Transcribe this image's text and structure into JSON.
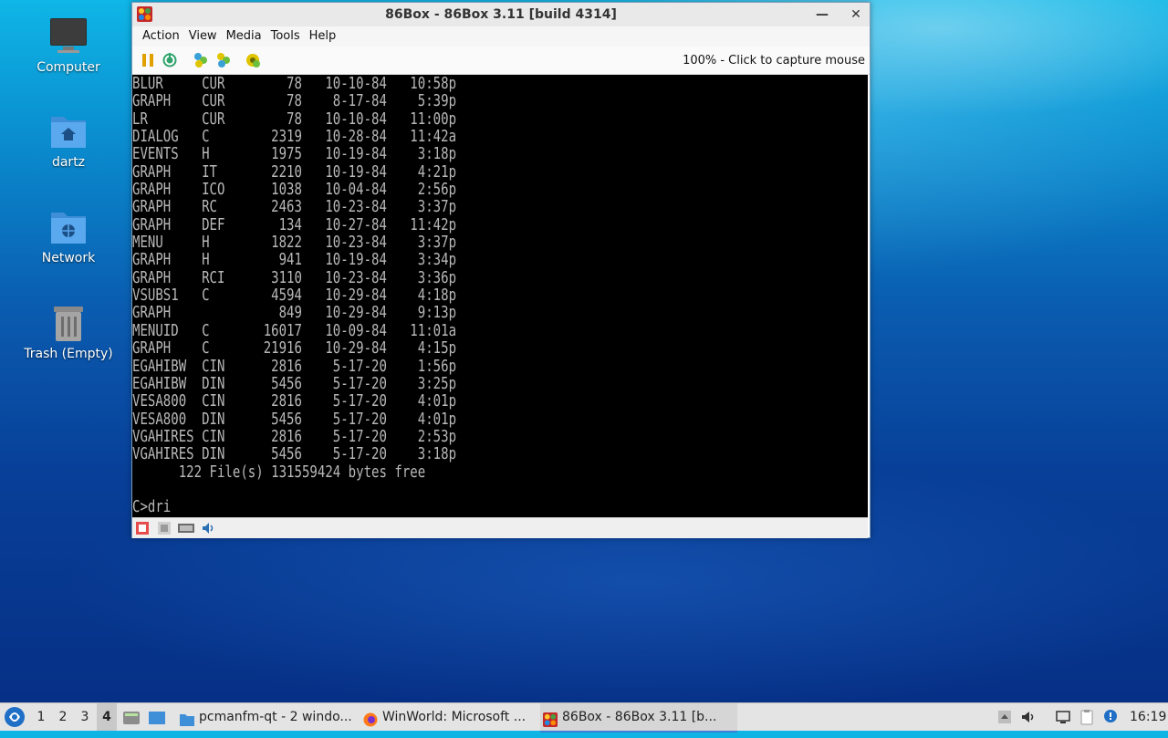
{
  "desktop": {
    "icons": [
      {
        "label": "Computer",
        "icon": "computer-icon"
      },
      {
        "label": "dartz",
        "icon": "home-folder-icon"
      },
      {
        "label": "Network",
        "icon": "network-folder-icon"
      },
      {
        "label": "Trash (Empty)",
        "icon": "trash-icon"
      }
    ]
  },
  "window": {
    "title": "86Box - 86Box 3.11 [build 4314]",
    "minimize": "—",
    "close": "✕",
    "menu": [
      "Action",
      "View",
      "Media",
      "Tools",
      "Help"
    ],
    "toolbar": {
      "buttons": [
        "pause-icon",
        "reset-icon",
        "ctrl-alt-del-icon",
        "ctrl-alt-esc-icon",
        "settings-icon"
      ],
      "status": "100% - Click to capture mouse"
    },
    "screen_text": "BLUR     CUR        78   10-10-84   10:58p\nGRAPH    CUR        78    8-17-84    5:39p\nLR       CUR        78   10-10-84   11:00p\nDIALOG   C        2319   10-28-84   11:42a\nEVENTS   H        1975   10-19-84    3:18p\nGRAPH    IT       2210   10-19-84    4:21p\nGRAPH    ICO      1038   10-04-84    2:56p\nGRAPH    RC       2463   10-23-84    3:37p\nGRAPH    DEF       134   10-27-84   11:42p\nMENU     H        1822   10-23-84    3:37p\nGRAPH    H         941   10-19-84    3:34p\nGRAPH    RCI      3110   10-23-84    3:36p\nVSUBS1   C        4594   10-29-84    4:18p\nGRAPH              849   10-29-84    9:13p\nMENUID   C       16017   10-09-84   11:01a\nGRAPH    C       21916   10-29-84    4:15p\nEGAHIBW  CIN      2816    5-17-20    1:56p\nEGAHIBW  DIN      5456    5-17-20    3:25p\nVESA800  CIN      2816    5-17-20    4:01p\nVESA800  DIN      5456    5-17-20    4:01p\nVGAHIRES CIN      2816    5-17-20    2:53p\nVGAHIRES DIN      5456    5-17-20    3:18p\n      122 File(s) 131559424 bytes free\n\nC>dri",
    "statusbar_icons": [
      "hard-disk-icon",
      "floppy-icon",
      "network-card-icon",
      "sound-icon"
    ]
  },
  "taskbar": {
    "desktops": [
      "1",
      "2",
      "3",
      "4"
    ],
    "active_desktop": "4",
    "tasks": [
      {
        "label": "pcmanfm-qt - 2 windo...",
        "icon": "folder-icon"
      },
      {
        "label": "WinWorld: Microsoft ...",
        "icon": "firefox-icon"
      },
      {
        "label": "86Box - 86Box 3.11 [b...",
        "icon": "86box-icon"
      }
    ],
    "clock": "16:19"
  },
  "colors": {
    "taskbar_bg": "#e4e4e4",
    "active_task_underline": "#3b7fd6",
    "terminal_fg": "#b8b8b8",
    "terminal_bg": "#000000"
  }
}
